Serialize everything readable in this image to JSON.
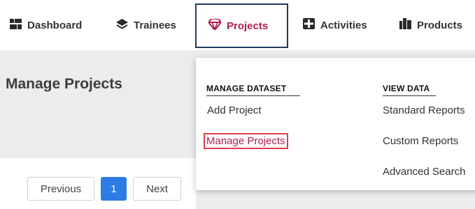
{
  "nav": {
    "items": [
      {
        "label": "Dashboard",
        "icon": "dashboard-icon"
      },
      {
        "label": "Trainees",
        "icon": "layers-icon"
      },
      {
        "label": "Projects",
        "icon": "gem-icon"
      },
      {
        "label": "Activities",
        "icon": "puzzle-icon"
      },
      {
        "label": "Products",
        "icon": "products-icon"
      }
    ],
    "active_color": "#b01d52"
  },
  "page": {
    "title": "Manage Projects"
  },
  "pagination": {
    "previous": "Previous",
    "current": "1",
    "next": "Next"
  },
  "menu": {
    "col1": {
      "heading": "MANAGE DATASET",
      "items": [
        "Add Project",
        "Manage Projects"
      ]
    },
    "col2": {
      "heading": "VIEW DATA",
      "items": [
        "Standard Reports",
        "Custom Reports",
        "Advanced Search"
      ]
    }
  }
}
